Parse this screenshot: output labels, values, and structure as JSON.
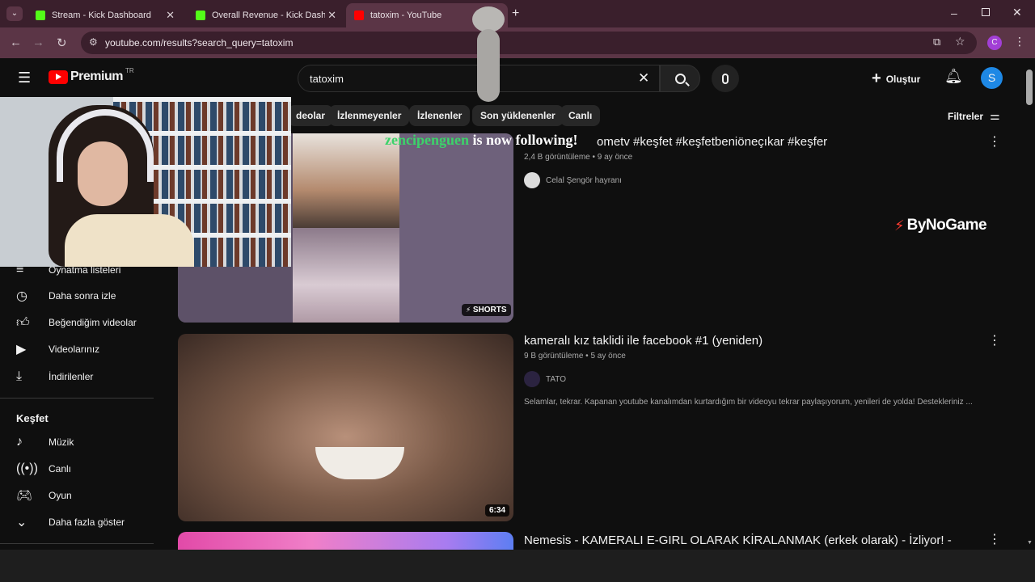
{
  "browser": {
    "tabs": [
      {
        "title": "Stream - Kick Dashboard"
      },
      {
        "title": "Overall Revenue - Kick Dashboard"
      },
      {
        "title": "tatoxim - YouTube"
      }
    ],
    "url": "youtube.com/results?search_query=tatoxim",
    "profile_initial": "C"
  },
  "header": {
    "logo": "Premium",
    "country": "TR",
    "search_value": "tatoxim",
    "create_label": "Oluştur",
    "avatar_initial": "S"
  },
  "chips": [
    "İzlenmeyenler",
    "İzlenenler",
    "Son yüklenenler",
    "Canlı"
  ],
  "chip_partial": "deolar",
  "filters_label": "Filtreler",
  "sidebar": {
    "items": [
      {
        "label": "Oynatma listeleri",
        "icon": "playlist-icon"
      },
      {
        "label": "Daha sonra izle",
        "icon": "clock-icon"
      },
      {
        "label": "Beğendiğim videolar",
        "icon": "thumbs-up-icon"
      },
      {
        "label": "Videolarınız",
        "icon": "video-icon"
      },
      {
        "label": "İndirilenler",
        "icon": "download-icon"
      }
    ],
    "explore_title": "Keşfet",
    "explore_items": [
      {
        "label": "Müzik",
        "icon": "music-icon"
      },
      {
        "label": "Canlı",
        "icon": "live-icon"
      },
      {
        "label": "Oyun",
        "icon": "game-icon"
      },
      {
        "label": "Daha fazla göster",
        "icon": "chevron-down-icon"
      }
    ]
  },
  "results": [
    {
      "title": "#tatoxim #fyp #kesfetomettv #keşfet #keşfetbeniöneçıkar #keşfer",
      "title_visible": "ometv #keşfet #keşfetbeniöneçıkar #keşfer",
      "views": "2,4 B görüntüleme",
      "age": "9 ay önce",
      "channel": "Celal Şengör hayranı",
      "badge": "SHORTS"
    },
    {
      "title": "kameralı kız taklidi ile facebook #1 (yeniden)",
      "views": "9 B görüntüleme",
      "age": "5 ay önce",
      "channel": "TATO",
      "description": "Selamlar, tekrar. Kapanan youtube kanalımdan kurtardığım bir videoyu tekrar paylaşıyorum, yenileri de yolda! Destekleriniz ...",
      "duration": "6:34"
    },
    {
      "title": "Nemesis - KAMERALI E-GIRL OLARAK KİRALANMAK (erkek olarak) - İzliyor! -"
    }
  ],
  "overlay": {
    "follower_name": "zencipenguen",
    "follower_text": " is now following!",
    "sponsor": "ByNoGame"
  },
  "colors": {
    "accent_red": "#ff0000",
    "follow_green": "#3cd36a",
    "chrome_bg": "#3a1f2c"
  }
}
